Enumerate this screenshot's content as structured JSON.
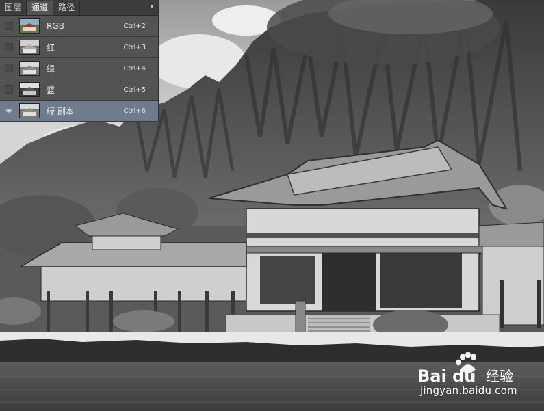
{
  "panel": {
    "tabs": [
      {
        "label": "图层",
        "active": false
      },
      {
        "label": "通道",
        "active": true
      },
      {
        "label": "路径",
        "active": false
      }
    ],
    "menu_icon": "panel-menu-icon",
    "channels": [
      {
        "name": "RGB",
        "shortcut": "Ctrl+2",
        "visible": false,
        "selected": false,
        "thumb": "color"
      },
      {
        "name": "红",
        "shortcut": "Ctrl+3",
        "visible": false,
        "selected": false,
        "thumb": "gray"
      },
      {
        "name": "绿",
        "shortcut": "Ctrl+4",
        "visible": false,
        "selected": false,
        "thumb": "gray"
      },
      {
        "name": "蓝",
        "shortcut": "Ctrl+5",
        "visible": false,
        "selected": false,
        "thumb": "dark"
      },
      {
        "name": "绿 副本",
        "shortcut": "Ctrl+6",
        "visible": true,
        "selected": true,
        "thumb": "gray"
      }
    ],
    "selected_row_color": "#6f7c8e"
  },
  "watermark": {
    "logo": "Bai du",
    "brand": "经验",
    "url": "jingyan.baidu.com"
  }
}
